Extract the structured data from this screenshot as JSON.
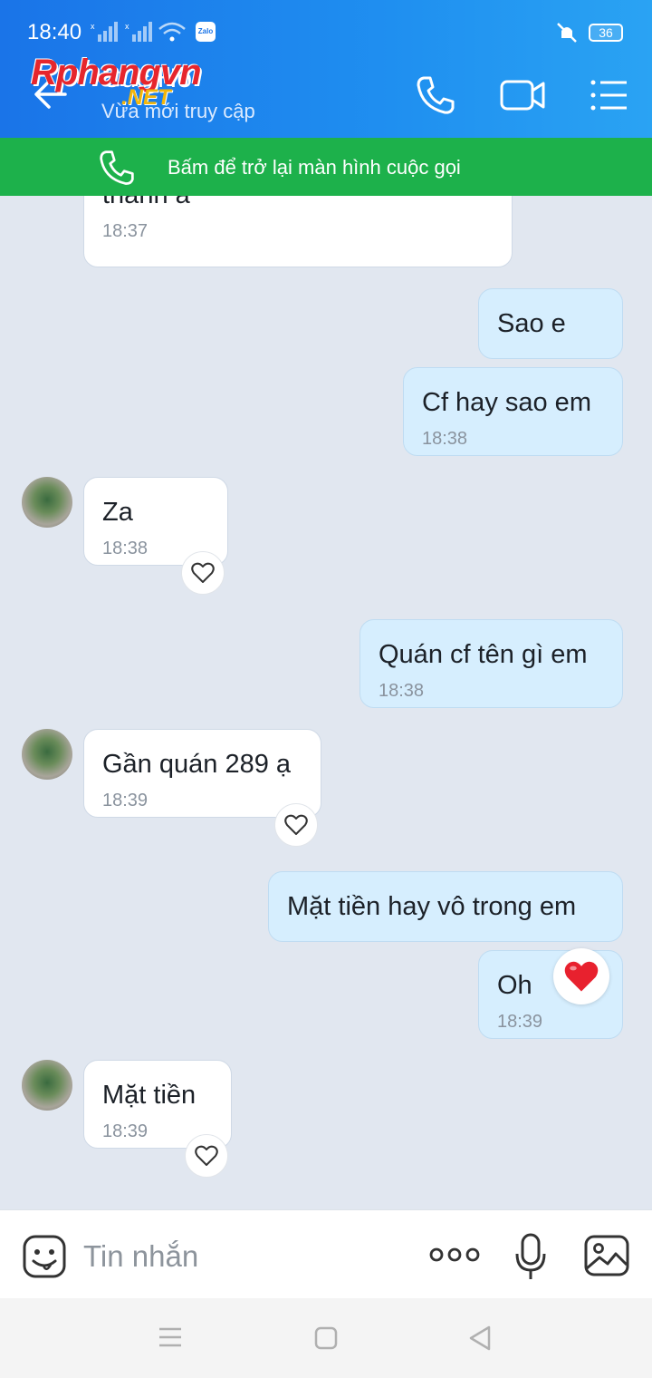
{
  "status_bar": {
    "time": "18:40",
    "battery": "36",
    "app_icon_label": "Zalo"
  },
  "header": {
    "contact_name": "Cuc Ho",
    "contact_status": "Vừa mới truy cập",
    "watermark_main": "Rphangvn",
    "watermark_sub": ".NET"
  },
  "call_banner": {
    "text": "Bấm để trở lại màn hình cuộc gọi"
  },
  "messages": [
    {
      "direction": "in",
      "text": "thành á",
      "time": "18:37"
    },
    {
      "direction": "out",
      "text": "Sao e",
      "time": ""
    },
    {
      "direction": "out",
      "text": "Cf hay sao em",
      "time": "18:38"
    },
    {
      "direction": "in",
      "text": "Za",
      "time": "18:38"
    },
    {
      "direction": "out",
      "text": "Quán cf tên gì em",
      "time": "18:38"
    },
    {
      "direction": "in",
      "text": "Gần quán 289 ạ",
      "time": "18:39"
    },
    {
      "direction": "out",
      "text": "Mặt tiền hay vô trong em",
      "time": ""
    },
    {
      "direction": "out",
      "text": "Oh",
      "time": "18:39",
      "reaction": "heart"
    },
    {
      "direction": "in",
      "text": "Mặt tiền",
      "time": "18:39"
    }
  ],
  "input": {
    "placeholder": "Tin nhắn"
  },
  "colors": {
    "header_blue": "#1a74e8",
    "call_banner_green": "#1db14b",
    "outgoing_bubble": "#d6eefe",
    "chat_background": "#e1e7f0",
    "reaction_heart": "#e8212e"
  }
}
